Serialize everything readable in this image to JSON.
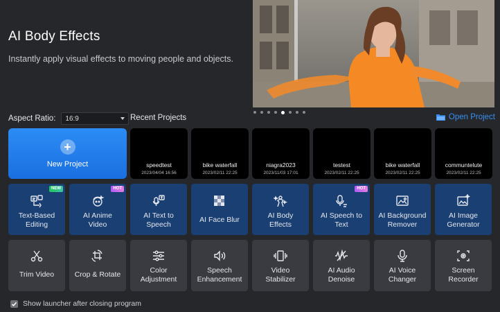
{
  "hero": {
    "title": "AI Body Effects",
    "subtitle": "Instantly apply visual effects to moving people and objects."
  },
  "carousel": {
    "count": 8,
    "active_index": 4
  },
  "aspect_ratio": {
    "label": "Aspect Ratio:",
    "value": "16:9"
  },
  "recent": {
    "label": "Recent Projects",
    "open_label": "Open Project",
    "new_project_label": "New Project",
    "projects": [
      {
        "name": "speedtest",
        "date": "2023/04/04 16:56"
      },
      {
        "name": "bike waterfall",
        "date": "2023/02/11 22:25"
      },
      {
        "name": "niagra2023",
        "date": "2023/11/03 17:01"
      },
      {
        "name": "testest",
        "date": "2023/02/11 22:25"
      },
      {
        "name": "bike waterfall",
        "date": "2023/02/11 22:25"
      },
      {
        "name": "communtelute",
        "date": "2023/02/11 22:25"
      }
    ]
  },
  "ai_tools": [
    {
      "label": "Text-Based\nEditing",
      "icon": "text-edit-icon",
      "badge": "NEW"
    },
    {
      "label": "AI Anime\nVideo",
      "icon": "anime-icon",
      "badge": "HOT"
    },
    {
      "label": "AI Text to\nSpeech",
      "icon": "text-to-speech-icon"
    },
    {
      "label": "AI Face Blur",
      "icon": "face-blur-icon"
    },
    {
      "label": "AI Body\nEffects",
      "icon": "body-effects-icon"
    },
    {
      "label": "AI Speech to\nText",
      "icon": "speech-to-text-icon",
      "badge": "HOT"
    },
    {
      "label": "AI Background\nRemover",
      "icon": "background-remover-icon"
    },
    {
      "label": "AI Image\nGenerator",
      "icon": "image-generator-icon"
    }
  ],
  "basic_tools": [
    {
      "label": "Trim Video",
      "icon": "scissors-icon"
    },
    {
      "label": "Crop & Rotate",
      "icon": "crop-rotate-icon"
    },
    {
      "label": "Color\nAdjustment",
      "icon": "sliders-icon"
    },
    {
      "label": "Speech\nEnhancement",
      "icon": "speech-enhance-icon"
    },
    {
      "label": "Video\nStabilizer",
      "icon": "stabilizer-icon"
    },
    {
      "label": "AI Audio\nDenoise",
      "icon": "audio-denoise-icon"
    },
    {
      "label": "AI Voice\nChanger",
      "icon": "microphone-icon"
    },
    {
      "label": "Screen\nRecorder",
      "icon": "screen-record-icon"
    }
  ],
  "launcher": {
    "label": "Show launcher after closing program",
    "checked": true
  },
  "colors": {
    "accent": "#2c8cf5",
    "ai_tile": "#1a3f73",
    "basic_tile": "#3a3b40",
    "background": "#26272b",
    "link": "#3a8ff0"
  }
}
